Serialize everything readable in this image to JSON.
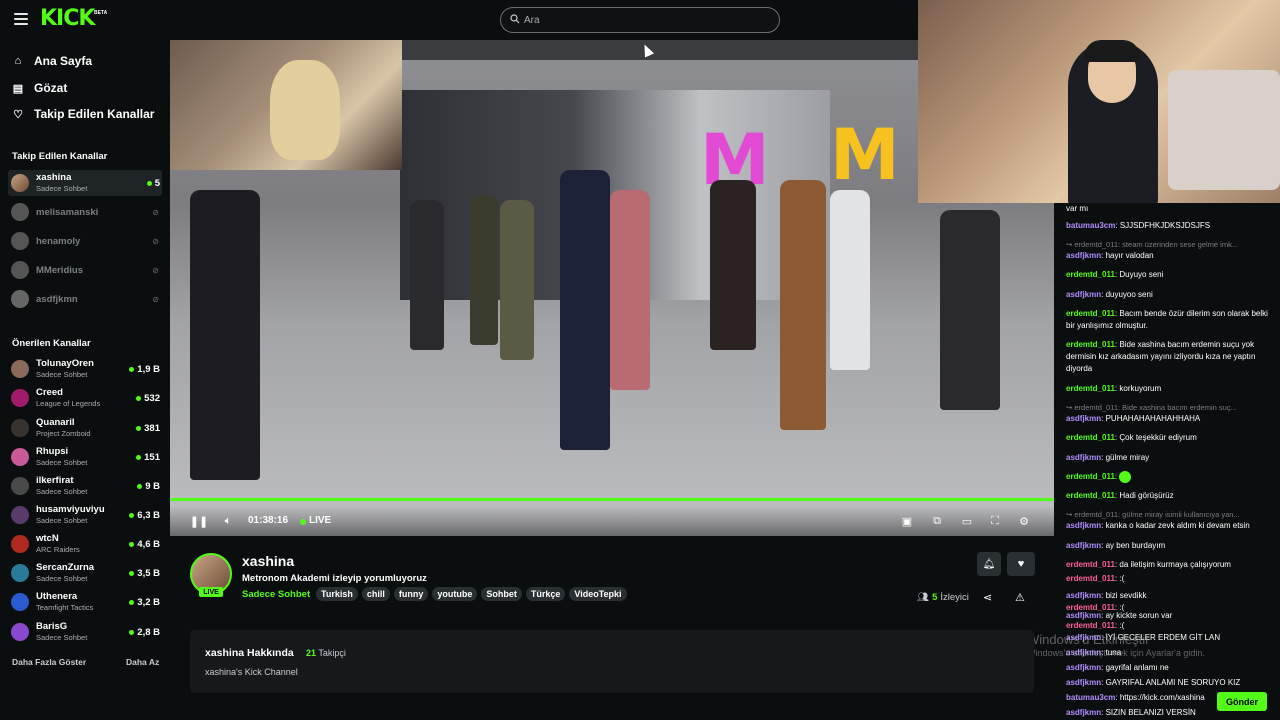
{
  "header": {
    "logo": "KICK",
    "logo_badge": "BETA",
    "search_placeholder": "Ara"
  },
  "nav": [
    {
      "label": "Ana Sayfa",
      "icon": "home-icon"
    },
    {
      "label": "Gözat",
      "icon": "browse-icon"
    },
    {
      "label": "Takip Edilen Kanallar",
      "icon": "heart-icon"
    }
  ],
  "followed_heading": "Takip Edilen Kanallar",
  "followed": [
    {
      "name": "xashina",
      "category": "Sadece Sohbet",
      "viewers": "5",
      "live": true
    },
    {
      "name": "melisamanski",
      "live": false
    },
    {
      "name": "henamoly",
      "live": false
    },
    {
      "name": "MMeridius",
      "live": false
    },
    {
      "name": "asdfjkmn",
      "live": false
    }
  ],
  "recommended_heading": "Önerilen Kanallar",
  "recommended": [
    {
      "name": "TolunayOren",
      "category": "Sadece Sohbet",
      "viewers": "1,9 B"
    },
    {
      "name": "Creed",
      "category": "League of Legends",
      "viewers": "532"
    },
    {
      "name": "Quanaril",
      "category": "Project Zomboid",
      "viewers": "381"
    },
    {
      "name": "Rhupsi",
      "category": "Sadece Sohbet",
      "viewers": "151"
    },
    {
      "name": "ilkerfirat",
      "category": "Sadece Sohbet",
      "viewers": "9 B"
    },
    {
      "name": "husamviyuviyu",
      "category": "Sadece Sohbet",
      "viewers": "6,3 B"
    },
    {
      "name": "wtcN",
      "category": "ARC Raiders",
      "viewers": "4,6 B"
    },
    {
      "name": "SercanZurna",
      "category": "Sadece Sohbet",
      "viewers": "3,5 B"
    },
    {
      "name": "Uthenera",
      "category": "Teamfight Tactics",
      "viewers": "3,2 B"
    },
    {
      "name": "BarisG",
      "category": "Sadece Sohbet",
      "viewers": "2,8 B"
    }
  ],
  "show_more": "Daha Fazla Göster",
  "show_less": "Daha Az",
  "player": {
    "time": "01:38:16",
    "live": "LIVE",
    "progress": 1.0
  },
  "stream": {
    "streamer": "xashina",
    "title": "Metronom Akademi izleyip yorumluyoruz",
    "category": "Sadece Sohbet",
    "tags": [
      "Turkish",
      "chill",
      "funny",
      "youtube",
      "Sohbet",
      "Türkçe",
      "VideoTepki"
    ],
    "live_badge": "LIVE",
    "viewers": "5",
    "viewers_label": "İzleyici"
  },
  "about": {
    "title": "xashina Hakkında",
    "followers": "21",
    "followers_label": "Takipçi",
    "description": "xashina's Kick Channel"
  },
  "chat": [
    {
      "type": "text",
      "text": "var mı"
    },
    {
      "type": "msg",
      "user": "batumau3cm",
      "color": "purple",
      "text": "SJJSDFHKJDKSJDSJFS"
    },
    {
      "type": "reply",
      "text": "erdemtd_011: steam üzerinden sese gelme imk..."
    },
    {
      "type": "msg",
      "user": "asdfjkmn",
      "color": "purple",
      "text": "hayır valodan"
    },
    {
      "type": "msg",
      "user": "erdemtd_011",
      "color": "green",
      "text": "Duyuyo seni"
    },
    {
      "type": "msg",
      "user": "asdfjkmn",
      "color": "purple",
      "text": "duyuyoo seni"
    },
    {
      "type": "msg",
      "user": "erdemtd_011",
      "color": "green",
      "text": "Bacım bende özür dilerim son olarak belki bir yanlışımız olmuştur."
    },
    {
      "type": "msg",
      "user": "erdemtd_011",
      "color": "green",
      "text": "Bide xashina bacım erdemin suçu yok dermisin kız arkadasım yayını izliyordu kıza ne yaptın diyorda"
    },
    {
      "type": "msg",
      "user": "erdemtd_011",
      "color": "green",
      "text": "korkuyorum"
    },
    {
      "type": "reply",
      "text": "erdemtd_011: Bide xashina bacım erdemin suç..."
    },
    {
      "type": "msg",
      "user": "asdfjkmn",
      "color": "purple",
      "text": "PUHAHAHAHAHAHHAHA"
    },
    {
      "type": "msg",
      "user": "erdemtd_011",
      "color": "green",
      "text": "Çok teşekkür ediyrum"
    },
    {
      "type": "msg",
      "user": "asdfjkmn",
      "color": "purple",
      "text": "gülme miray"
    },
    {
      "type": "msg",
      "user": "erdemtd_011",
      "color": "green",
      "text": "",
      "emote": true
    },
    {
      "type": "msg",
      "user": "erdemtd_011",
      "color": "green",
      "text": "Hadi görüşürüz"
    },
    {
      "type": "reply",
      "text": "erdemtd_011: gülme miray isimli kullanıcıya yan..."
    },
    {
      "type": "msg",
      "user": "asdfjkmn",
      "color": "purple",
      "text": "kanka o kadar zevk aldım ki devam etsin"
    },
    {
      "type": "msg",
      "user": "asdfjkmn",
      "color": "purple",
      "text": "ay ben burdayım"
    },
    {
      "type": "msg",
      "user": "erdemtd_011",
      "color": "pink",
      "text": "da iletişim kurmaya çalışıyorum"
    },
    {
      "type": "msg",
      "user": "erdemtd_011",
      "color": "pink",
      "text": ":("
    },
    {
      "type": "msg",
      "user": "asdfjkmn",
      "color": "purple",
      "text": "bizi sevdikk"
    },
    {
      "type": "msg",
      "user": "erdemtd_011",
      "color": "pink",
      "text": ":("
    },
    {
      "type": "msg",
      "user": "asdfjkmn",
      "color": "purple",
      "text": "ay kickte sorun var"
    },
    {
      "type": "msg",
      "user": "erdemtd_011",
      "color": "pink",
      "text": ":("
    },
    {
      "type": "msg",
      "user": "asdfjkmn",
      "color": "purple",
      "text": "İYİ GECELER ERDEM GİT LAN"
    },
    {
      "type": "msg",
      "user": "asdfjkmn",
      "color": "purple",
      "text": "tuna"
    },
    {
      "type": "msg",
      "user": "asdfjkmn",
      "color": "purple",
      "text": "gayrifal anlamı ne"
    },
    {
      "type": "msg",
      "user": "asdfjkmn",
      "color": "purple",
      "text": "GAYRIFAL ANLAMI NE SORUYO KIZ"
    },
    {
      "type": "msg",
      "user": "batumau3cm",
      "color": "purple",
      "text": "https://kick.com/xashina"
    },
    {
      "type": "msg",
      "user": "asdfjkmn",
      "color": "purple",
      "text": "SIZIN BELANIZI VERSİN"
    }
  ],
  "send_label": "Gönder",
  "watermark_line1": "Windows'u Etkinleştir",
  "watermark_line2": "Windows'u etkinleştirmek için Ayarlar'a gidin."
}
